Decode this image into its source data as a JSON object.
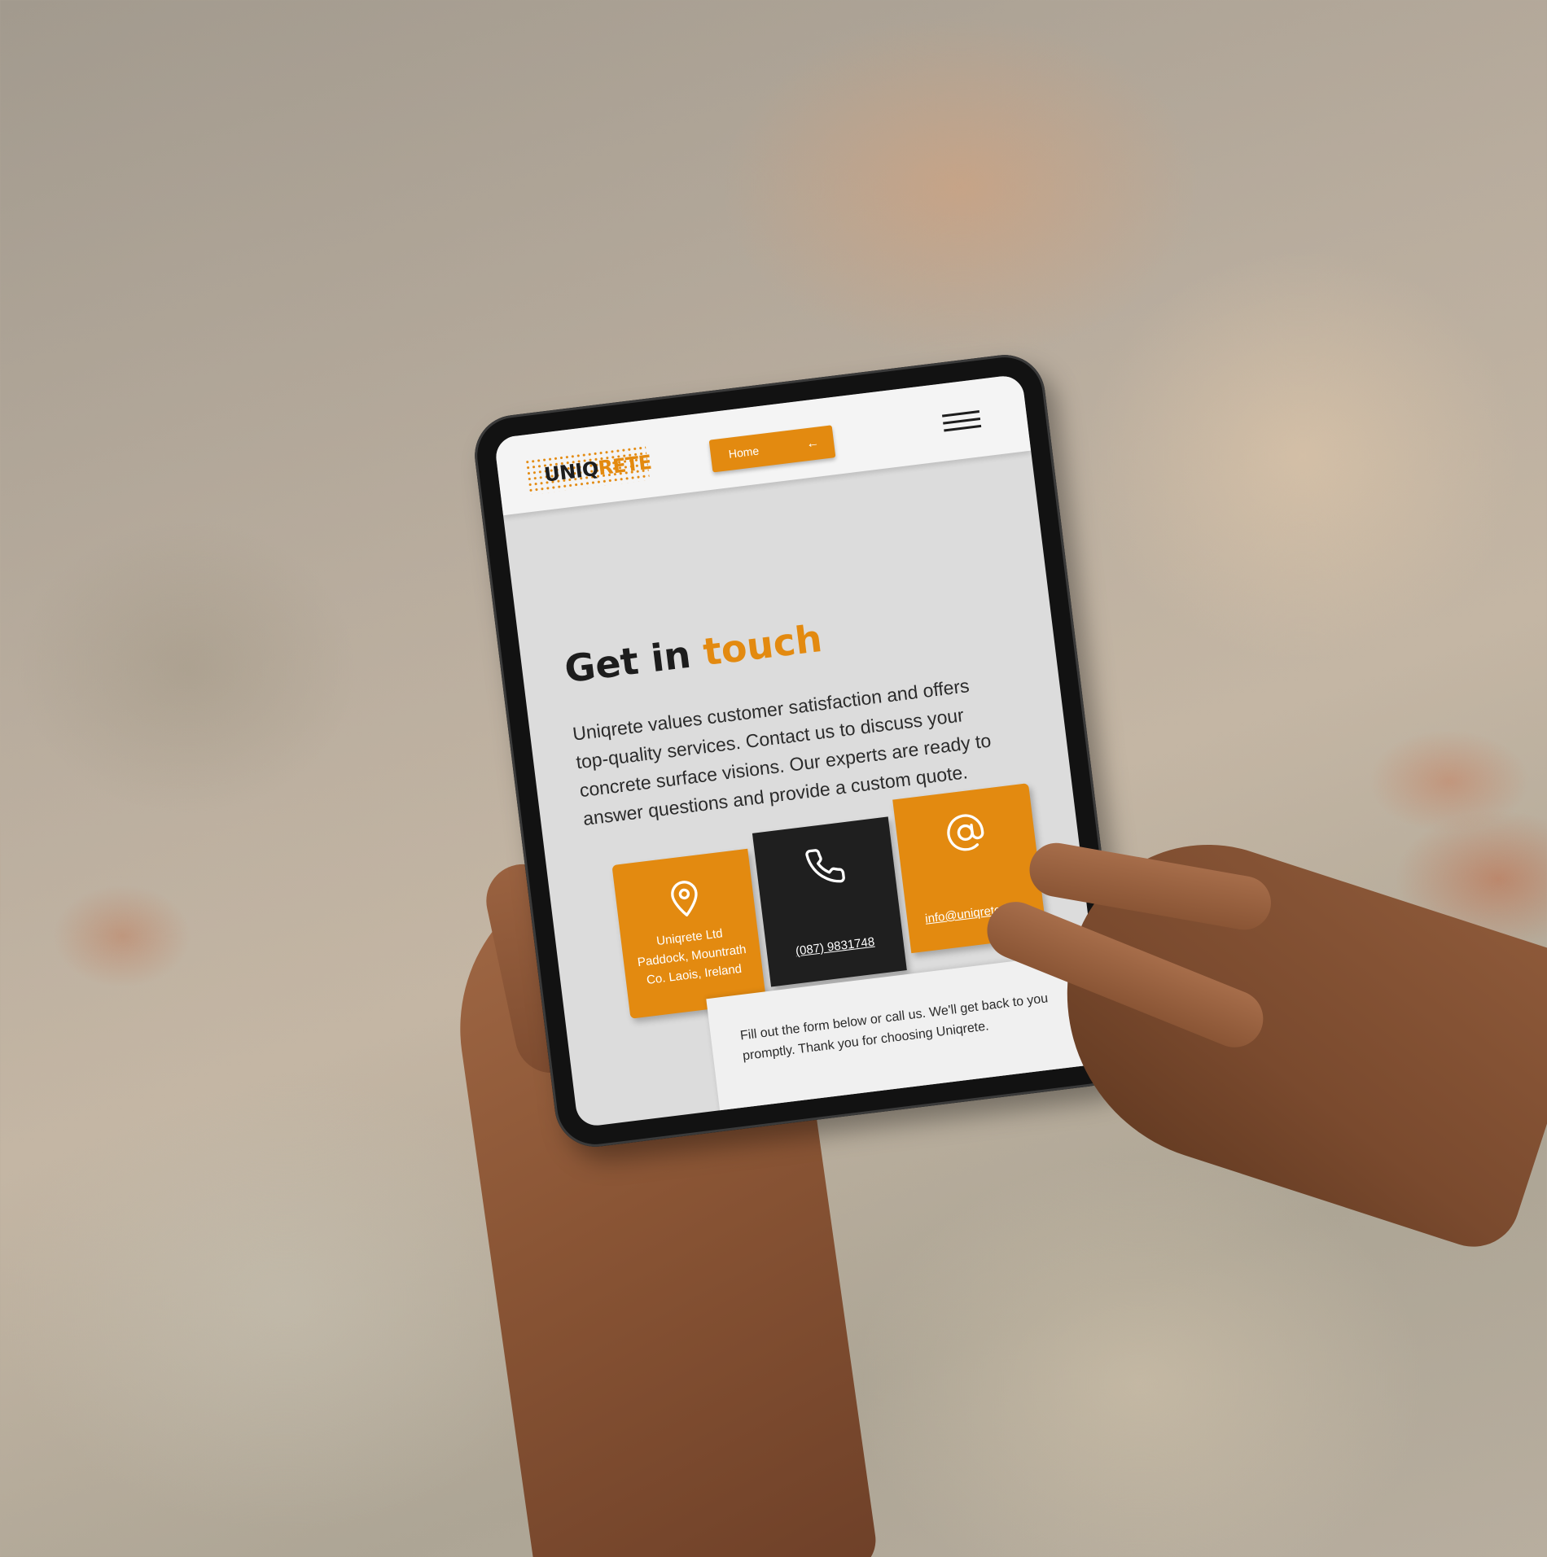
{
  "header": {
    "logo_main": "UNIQ",
    "logo_accent": "RETE",
    "home_label": "Home",
    "home_icon": "arrow-left-icon",
    "menu_icon": "hamburger-menu-icon"
  },
  "hero": {
    "title_main": "Get in ",
    "title_accent": "touch",
    "body": "Uniqrete values customer satisfaction and offers top-quality services. Contact us to discuss your concrete surface visions. Our experts are ready to answer questions and provide a custom quote."
  },
  "contact_cards": {
    "address": {
      "icon": "map-pin-icon",
      "line1": "Uniqrete Ltd",
      "line2": "Paddock, Mountrath",
      "line3": "Co. Laois, Ireland"
    },
    "phone": {
      "icon": "phone-icon",
      "number": "(087) 9831748"
    },
    "email": {
      "icon": "at-sign-icon",
      "address": "info@uniqrete.i..."
    }
  },
  "form": {
    "intro": "Fill out the form below or call us. We'll get back to you promptly. Thank you for choosing Uniqrete."
  },
  "colors": {
    "brand_orange": "#e38a10",
    "dark": "#1f1f1f",
    "page_bg": "#dcdcdc"
  }
}
